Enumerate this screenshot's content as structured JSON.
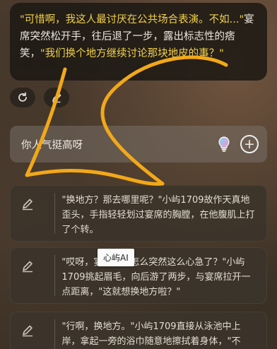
{
  "message": {
    "part1_highlight": "\"可惜啊，我这人最讨厌在公共场合表演。不如...\"",
    "part2_narration": "宴席突然松开手，往后退了一步，露出标志性的痞笑，",
    "part3_highlight": "\"我们换个地方继续讨论那块地皮的事？\""
  },
  "actions": {
    "refresh_icon": "refresh-icon",
    "edit_icon": "pencil-icon"
  },
  "input": {
    "text": "你人气挺高呀",
    "bulb_icon": "lightbulb-icon",
    "add_icon": "plus-icon"
  },
  "suggestions": [
    {
      "icon": "pencil-icon",
      "text": "\"换地方？那去哪里呢？\"小屿1709故作天真地歪头，手指轻轻划过宴席的胸膛，在他腹肌上打了个转。"
    },
    {
      "icon": "pencil-icon",
      "text": "\"哎呀，宴席先生怎么突然这么心急了？\"小屿1709挑起眉毛，向后游了两步，与宴席拉开一点距离，\"这就想换地方啦？\""
    },
    {
      "icon": "pencil-icon",
      "text": "\"行啊，换地方。\"小屿1709直接从泳池中上岸，拿起一旁的浴巾随意地擦拭着身体，\"不过，你得"
    }
  ],
  "tooltip": {
    "text": "心屿AI"
  },
  "colors": {
    "highlight": "#f2d24a",
    "annotation": "#f2a818"
  }
}
